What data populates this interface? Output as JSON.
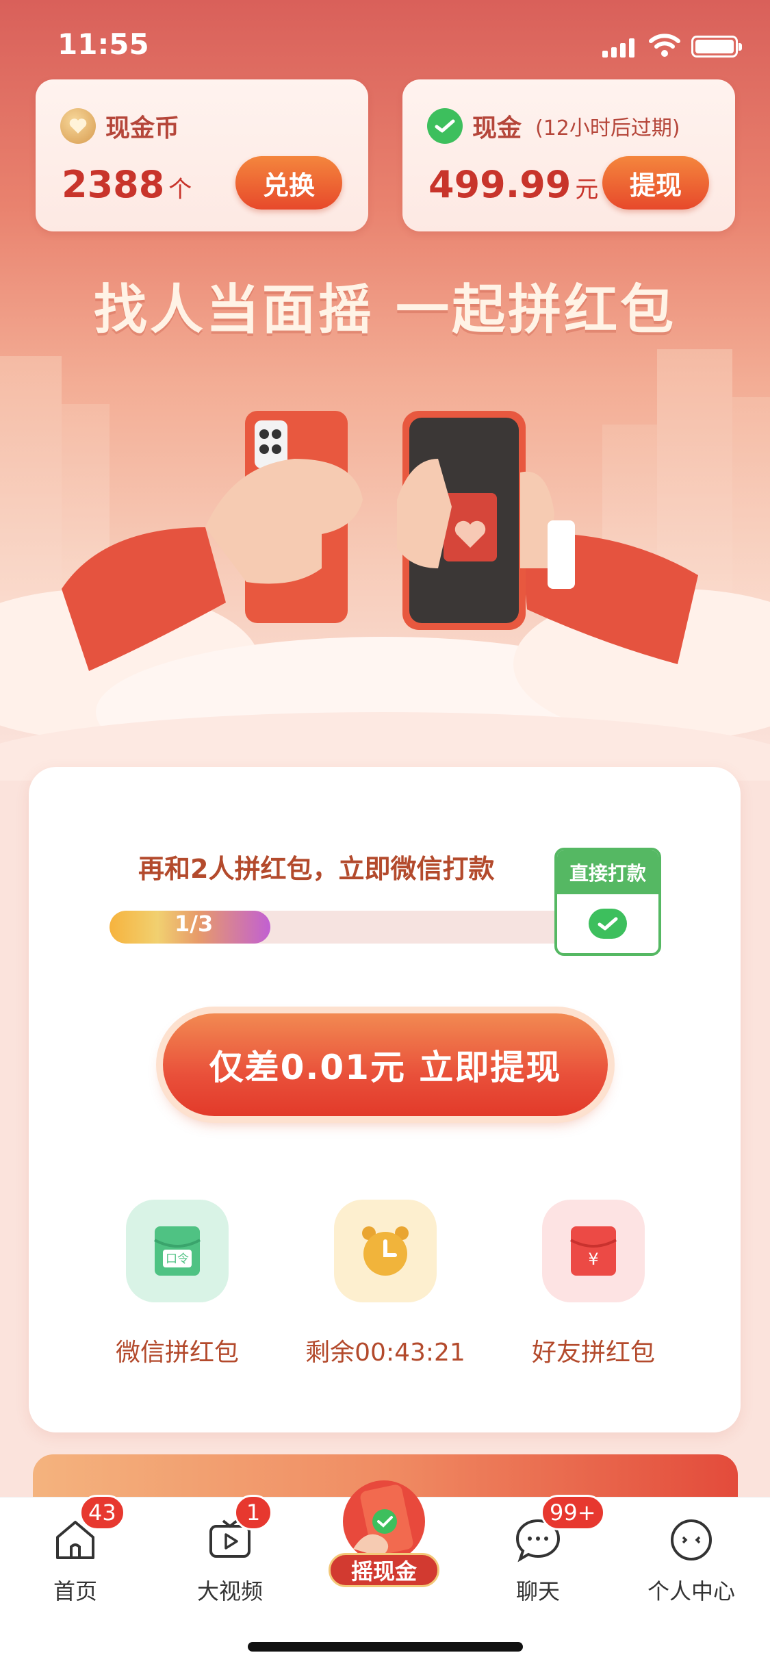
{
  "status_bar": {
    "time": "11:55"
  },
  "wallet": {
    "coins": {
      "label": "现金币",
      "value": "2388",
      "unit": "个",
      "button": "兑换"
    },
    "cash": {
      "label": "现金",
      "note": "(12小时后过期)",
      "value": "499.99",
      "unit": "元",
      "button": "提现"
    }
  },
  "headline": "找人当面摇 一起拼红包",
  "progress": {
    "title": "再和2人拼红包，立即微信打款",
    "text": "1/3",
    "fraction": 0.3333,
    "direct_pay_label": "直接打款"
  },
  "cta": {
    "label": "仅差0.01元 立即提现"
  },
  "features": [
    {
      "label": "微信拼红包",
      "icon": "wechat-redpacket-icon",
      "icon_text": "口令"
    },
    {
      "label": "剩余00:43:21",
      "icon": "alarm-clock-icon"
    },
    {
      "label": "好友拼红包",
      "icon": "friend-redpacket-icon",
      "icon_text": "¥"
    }
  ],
  "tabbar": {
    "home": {
      "label": "首页",
      "badge": "43"
    },
    "video": {
      "label": "大视频",
      "badge": "1"
    },
    "shake": {
      "label": "摇现金"
    },
    "chat": {
      "label": "聊天",
      "badge": "99+"
    },
    "profile": {
      "label": "个人中心"
    }
  },
  "colors": {
    "accent": "#e7492b",
    "wechat_green": "#3dbf5d",
    "text_brown": "#b34a2c"
  }
}
